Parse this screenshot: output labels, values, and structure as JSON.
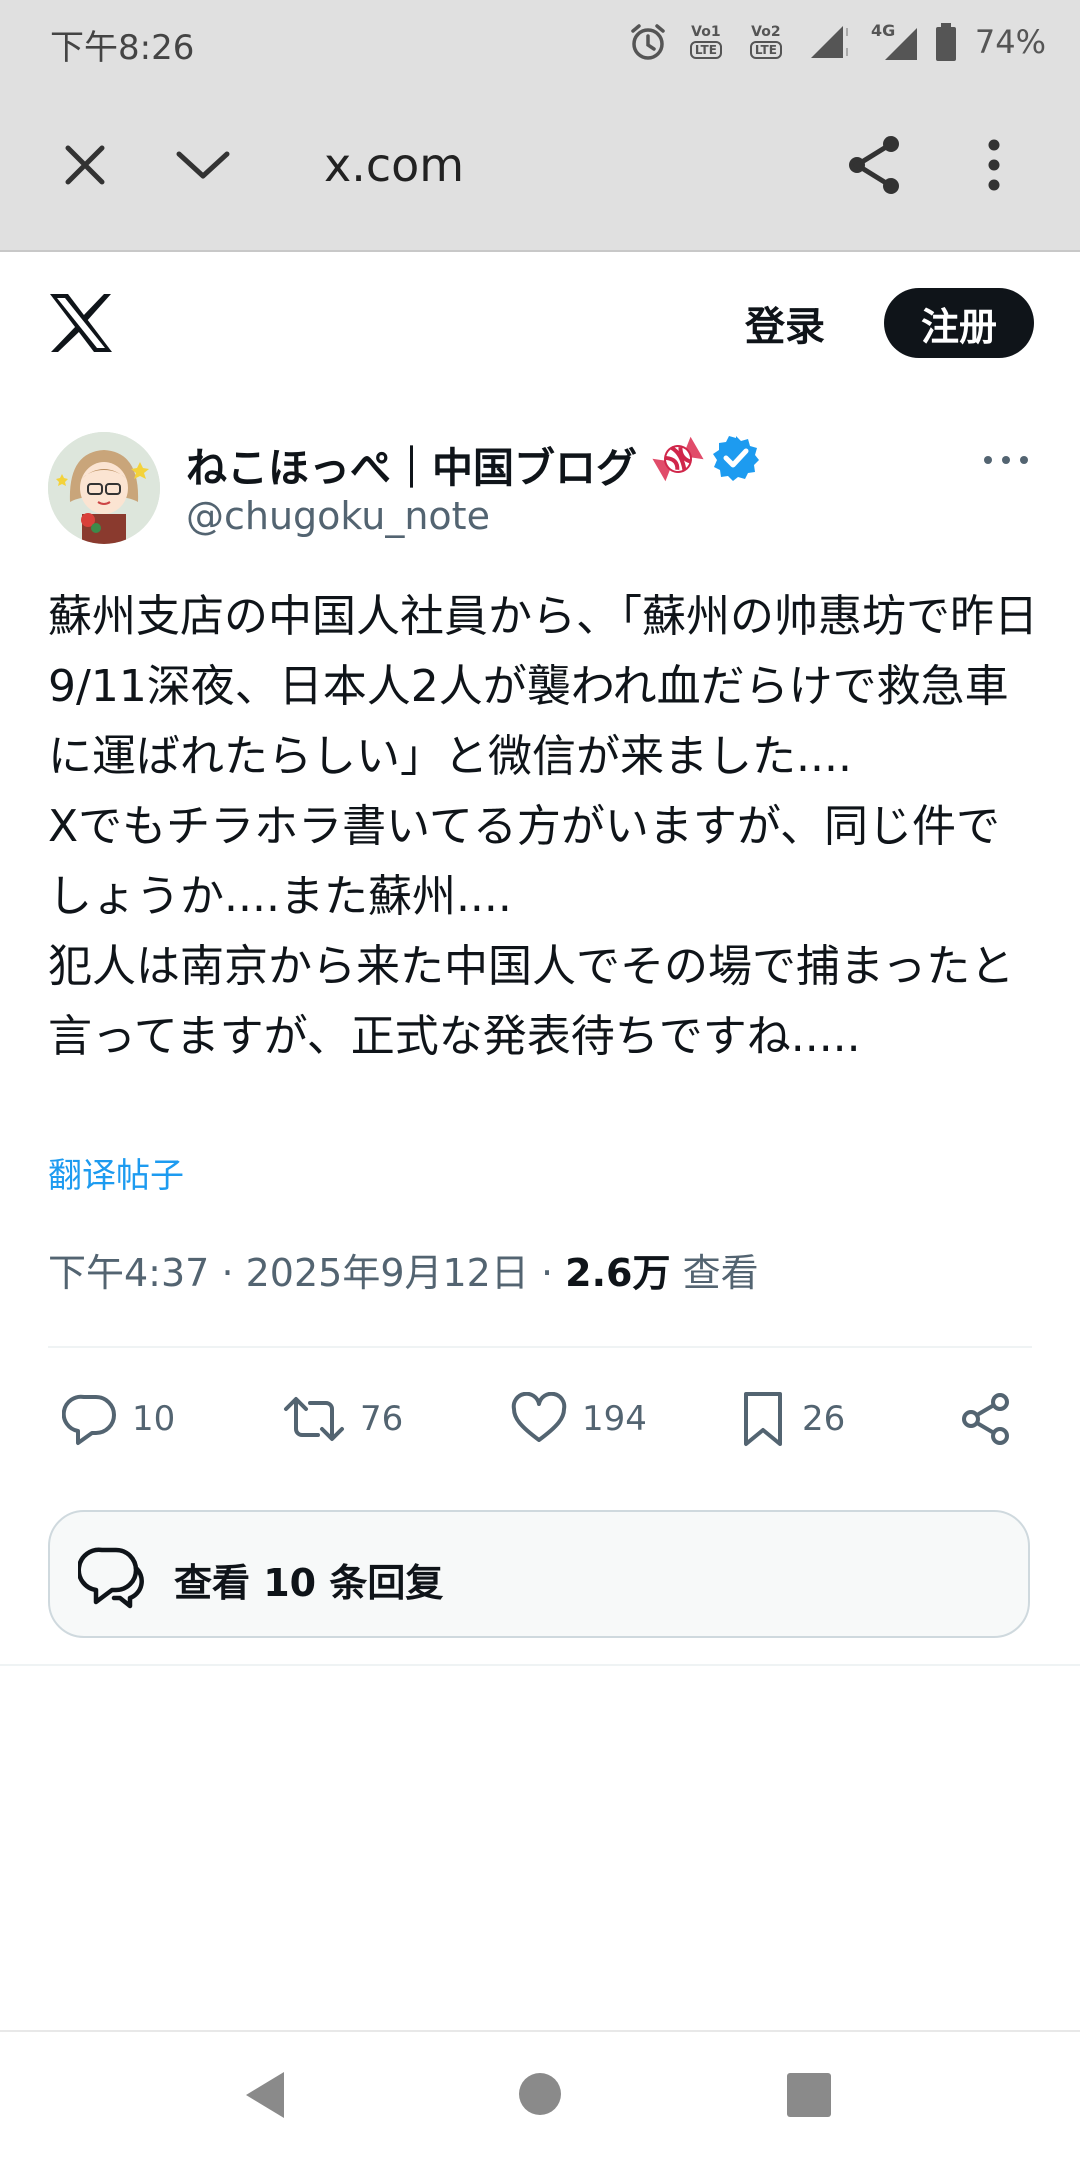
{
  "status_bar": {
    "time": "下午8:26",
    "volte1": "Vo1",
    "volte2": "Vo2",
    "lte": "LTE",
    "network": "4G",
    "battery": "74%"
  },
  "browser": {
    "url": "x.com",
    "icons": [
      "close-icon",
      "chevron-down-icon",
      "share-icon",
      "more-vertical-icon"
    ]
  },
  "header": {
    "login_label": "登录",
    "signup_label": "注册"
  },
  "tweet": {
    "display_name": "ねこほっぺ｜中国ブログ",
    "handle": "@chugoku_note",
    "text": "蘇州支店の中国人社員から、「蘇州の帅惠坊で昨日9/11深夜、日本人2人が襲われ血だらけで救急車に運ばれたらしい」と微信が来ました....\nXでもチラホラ書いてる方がいますが、同じ件でしょうか....また蘇州....\n犯人は南京から来た中国人でその場で捕まったと言ってますが、正式な発表待ちですね.....",
    "translate_label": "翻译帖子",
    "time": "下午4:37",
    "date": "2025年9月12日",
    "views_count": "2.6万",
    "views_label": "查看",
    "sep": "·"
  },
  "actions": {
    "replies": "10",
    "reposts": "76",
    "likes": "194",
    "bookmarks": "26"
  },
  "replies_button": {
    "label": "查看 10 条回复"
  },
  "colors": {
    "accent": "#1d9bf0",
    "text": "#0f1419",
    "secondary": "#536471",
    "chrome": "#e0e0e0"
  }
}
